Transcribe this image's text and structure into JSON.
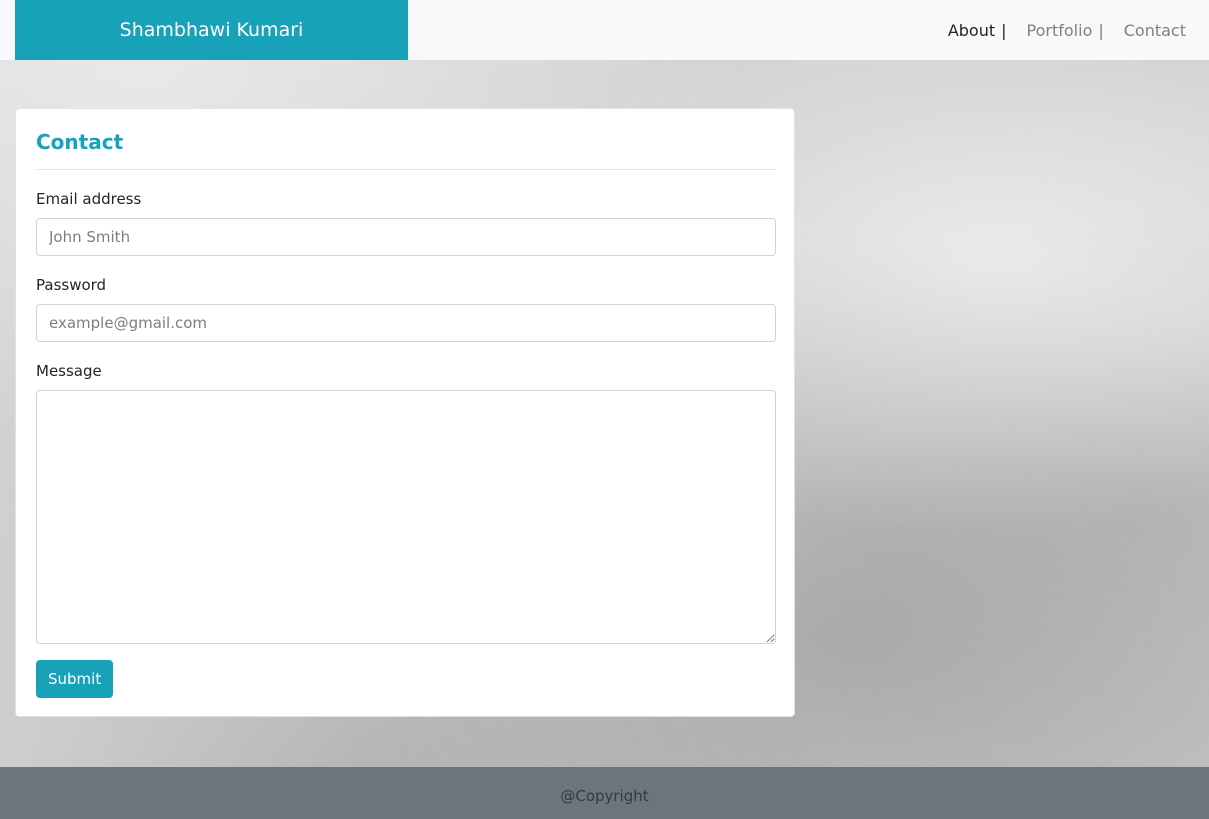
{
  "navbar": {
    "brand": "Shambhawi Kumari",
    "links": [
      {
        "label": "About",
        "separator": "|"
      },
      {
        "label": "Portfolio",
        "separator": "|"
      },
      {
        "label": "Contact"
      }
    ]
  },
  "contact_form": {
    "title": "Contact",
    "email": {
      "label": "Email address",
      "placeholder": "John Smith",
      "value": ""
    },
    "password": {
      "label": "Password",
      "placeholder": "example@gmail.com",
      "value": ""
    },
    "message": {
      "label": "Message",
      "value": ""
    },
    "submit_label": "Submit"
  },
  "footer": {
    "text": "@Copyright"
  },
  "colors": {
    "accent": "#17a2b8",
    "navbar_bg": "#f8f9fa",
    "footer_bg": "#6c757d"
  }
}
